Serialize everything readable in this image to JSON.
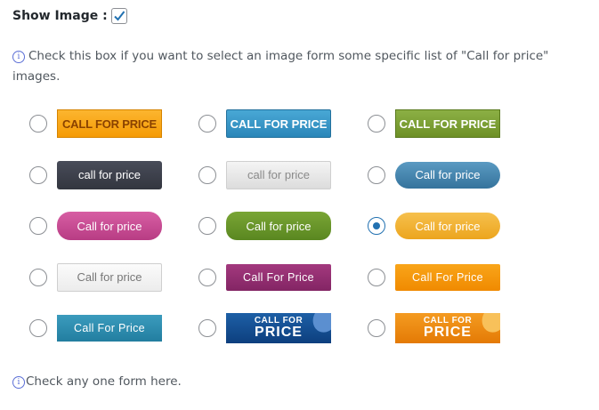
{
  "show_image": {
    "label": "Show Image :",
    "checked": true
  },
  "info": {
    "icon": "info-icon",
    "text": "Check this box if you want to select an image form some specific list of \"Call for price\" images."
  },
  "options": [
    {
      "text": "CALL FOR PRICE",
      "style": "orange-caps",
      "checked": false
    },
    {
      "text": "CALL FOR PRICE",
      "style": "blue-caps",
      "checked": false
    },
    {
      "text": "CALL FOR PRICE",
      "style": "green-caps",
      "checked": false
    },
    {
      "text": "call for price",
      "style": "dark",
      "checked": false
    },
    {
      "text": "call for price",
      "style": "lightgray",
      "checked": false
    },
    {
      "text": "Call for price",
      "style": "steel",
      "checked": false
    },
    {
      "text": "Call for price",
      "style": "pink",
      "checked": false
    },
    {
      "text": "Call for price",
      "style": "green-pill",
      "checked": false
    },
    {
      "text": "Call for price",
      "style": "amber-pill",
      "checked": true
    },
    {
      "text": "Call for price",
      "style": "white",
      "checked": false
    },
    {
      "text": "Call For Price",
      "style": "purple",
      "checked": false
    },
    {
      "text": "Call For Price",
      "style": "orange-flat",
      "checked": false
    },
    {
      "text": "Call For Price",
      "style": "teal",
      "checked": false
    },
    {
      "text": "CALL FOR",
      "text2": "PRICE",
      "style": "ribbon-blue",
      "checked": false
    },
    {
      "text": "CALL FOR",
      "text2": "PRICE",
      "style": "ribbon-orange",
      "checked": false
    }
  ],
  "footer": {
    "icon": "info-icon",
    "text": "Check any one form here."
  }
}
